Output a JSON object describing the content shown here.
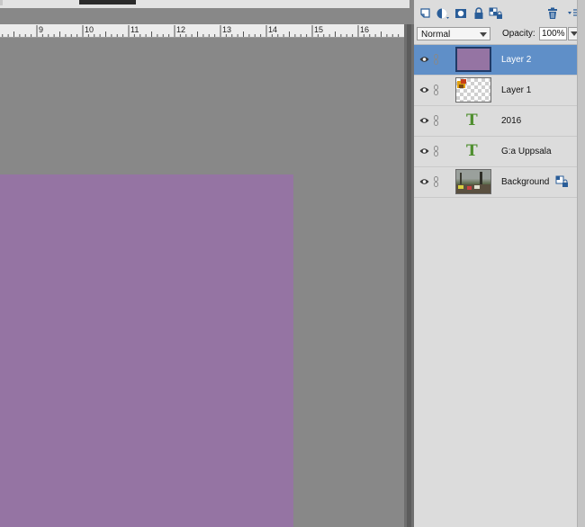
{
  "colors": {
    "canvas_gray": "#888888",
    "layer_fill_purple": "#9574a3",
    "selection_blue": "#5f8fc8",
    "text_layer_green": "#4f8f2f"
  },
  "ruler": {
    "labels": [
      "9",
      "10",
      "11",
      "12",
      "13",
      "14",
      "15",
      "16"
    ]
  },
  "toolbar": {
    "icons": [
      "new-layer-icon",
      "adjustment-layer-icon",
      "layer-mask-icon",
      "lock-icon",
      "lock-transparent-icon",
      "trash-icon",
      "panel-menu-icon"
    ]
  },
  "layers_panel": {
    "blend_mode": "Normal",
    "opacity_label": "Opacity:",
    "opacity_value": "100%",
    "layers": [
      {
        "name": "Layer 2",
        "type": "fill",
        "selected": true
      },
      {
        "name": "Layer 1",
        "type": "image-transparent",
        "selected": false
      },
      {
        "name": "2016",
        "type": "text",
        "selected": false
      },
      {
        "name": "G:a Uppsala",
        "type": "text",
        "selected": false
      },
      {
        "name": "Background",
        "type": "photo",
        "selected": false,
        "locked": true
      }
    ],
    "text_layer_glyph": "T"
  }
}
